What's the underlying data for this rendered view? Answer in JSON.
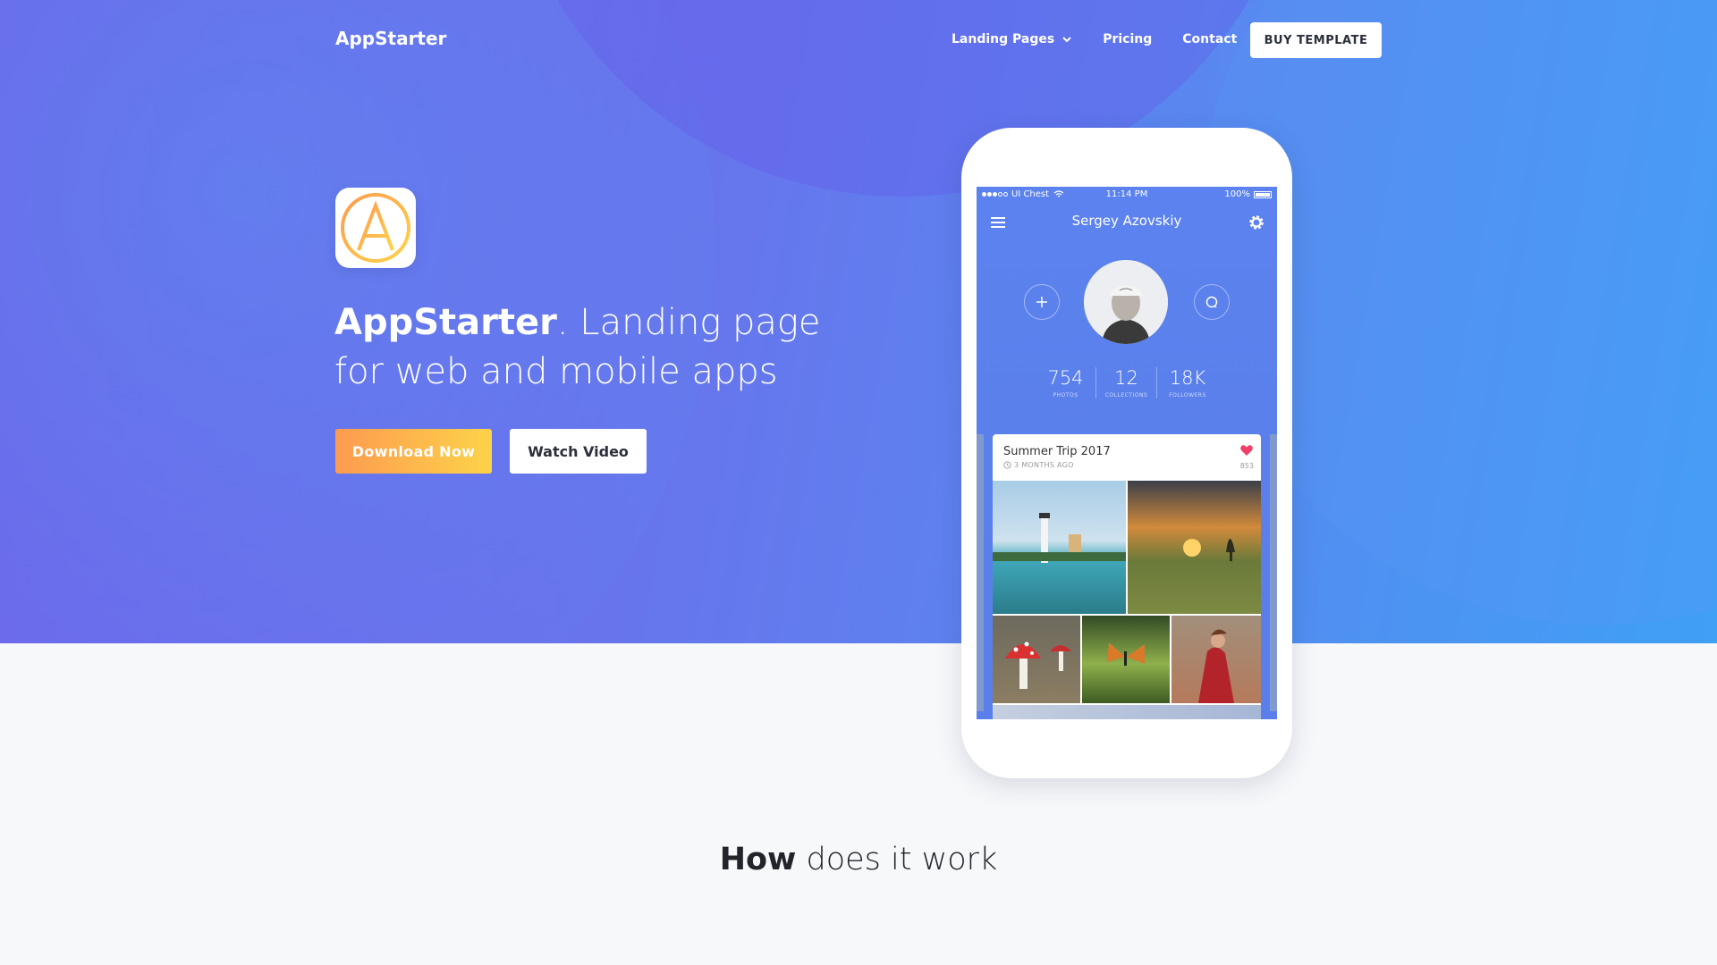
{
  "nav": {
    "logo": "AppStarter",
    "items": [
      {
        "label": "Landing Pages",
        "has_dropdown": true
      },
      {
        "label": "Pricing"
      },
      {
        "label": "Contact"
      }
    ],
    "buy_label": "BUY TEMPLATE"
  },
  "hero": {
    "icon": "appstarter-logo-icon",
    "headline_strong": "AppStarter",
    "headline_rest": ". Landing page for web and mobile apps",
    "download_label": "Download Now",
    "video_label": "Watch Video",
    "download_gradient": [
      "#fd9b4f",
      "#fdd34a"
    ]
  },
  "phone": {
    "status": {
      "carrier": "UI Chest",
      "time": "11:14 PM",
      "battery": "100%"
    },
    "profile_name": "Sergey Azovskiy",
    "stats": [
      {
        "value": "754",
        "label": "PHOTOS"
      },
      {
        "value": "12",
        "label": "COLLECTIONS"
      },
      {
        "value": "18K",
        "label": "FOLLOWERS"
      }
    ],
    "card": {
      "title": "Summer Trip 2017",
      "time": "3 MONTHS AGO",
      "likes": "853"
    }
  },
  "section": {
    "title_strong": "How",
    "title_rest": " does it work"
  },
  "colors": {
    "hero_start": "#6f63ea",
    "hero_end": "#3fa0f5",
    "text_dark": "#22242b",
    "heart": "#f0406a"
  }
}
